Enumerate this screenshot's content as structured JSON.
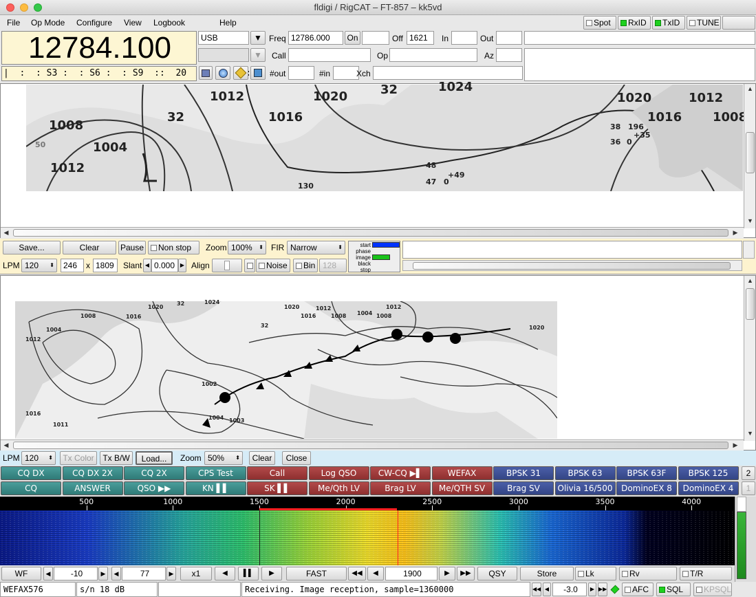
{
  "window": {
    "title": "fldigi / RigCAT – FT-857 – kk5vd"
  },
  "menu": [
    "File",
    "Op Mode",
    "Configure",
    "View",
    "Logbook",
    "Help"
  ],
  "indicators": {
    "spot": "Spot",
    "rxid": "RxID",
    "txid": "TxID",
    "tune": "TUNE"
  },
  "rig": {
    "frequency": "12784.100",
    "smeter": "|  :  : S3 :  : S6 :  : S9  ::  20  ::  40  ::  |",
    "mode": "USB",
    "bw": ""
  },
  "log": {
    "freq_label": "Freq",
    "freq_value": "12786.000",
    "on_label": "On",
    "on_value": "",
    "off_label": "Off",
    "off_value": "1621",
    "in_label": "In",
    "in_value": "",
    "out_label": "Out",
    "out_value": "",
    "call_label": "Call",
    "call_value": "",
    "op_label": "Op",
    "op_value": "",
    "az_label": "Az",
    "az_value": "",
    "nout_label": "#out",
    "nout_value": "",
    "nin_label": "#in",
    "nin_value": "",
    "xch_label": "Xch",
    "xch_value": ""
  },
  "rx_map_labels": [
    "1012",
    "1020",
    "1024",
    "32",
    "1008",
    "1016",
    "1004",
    "50",
    "1012",
    "1020",
    "1012",
    "1016",
    "1008",
    "32",
    "48",
    "47",
    "130",
    "38",
    "196",
    "36",
    "0",
    "+35",
    "+49",
    "0"
  ],
  "rx_controls": {
    "save": "Save...",
    "clear": "Clear",
    "pause": "Pause",
    "nonstop": "Non stop",
    "zoom_label": "Zoom",
    "zoom_value": "100%",
    "fir_label": "FIR",
    "fir_value": "Narrow",
    "lpm_label": "LPM",
    "lpm_value": "120",
    "width": "246",
    "x": "x",
    "height": "1809",
    "slant_label": "Slant",
    "slant_value": "0.000",
    "align_label": "Align",
    "noise": "Noise",
    "bin": "Bin",
    "bin_value": "128",
    "phases": [
      "start",
      "phase",
      "image",
      "black",
      "stop"
    ]
  },
  "tx_map_labels": [
    "1020",
    "32",
    "1024",
    "1008",
    "1004",
    "1012",
    "1016",
    "1020",
    "1016",
    "1008",
    "1012",
    "1004",
    "1008",
    "1012",
    "1020",
    "1016",
    "1011",
    "1002",
    "1004",
    "1003",
    "32"
  ],
  "tx_controls": {
    "lpm_label": "LPM",
    "lpm_value": "120",
    "tx_color": "Tx Color",
    "tx_bw": "Tx B/W",
    "load": "Load...",
    "zoom_label": "Zoom",
    "zoom_value": "50%",
    "clear": "Clear",
    "close": "Close"
  },
  "macros_row1": [
    {
      "label": "CQ DX",
      "color": "g"
    },
    {
      "label": "CQ DX 2X",
      "color": "g"
    },
    {
      "label": "CQ 2X",
      "color": "g"
    },
    {
      "label": "CPS Test",
      "color": "g"
    },
    {
      "label": "Call",
      "color": "r"
    },
    {
      "label": "Log QSO",
      "color": "r"
    },
    {
      "label": "CW-CQ ▶▌",
      "color": "r"
    },
    {
      "label": "WEFAX",
      "color": "r"
    },
    {
      "label": "BPSK 31",
      "color": "b"
    },
    {
      "label": "BPSK 63",
      "color": "b"
    },
    {
      "label": "BPSK 63F",
      "color": "b"
    },
    {
      "label": "BPSK 125",
      "color": "b"
    }
  ],
  "macros_row2": [
    {
      "label": "CQ",
      "color": "g"
    },
    {
      "label": "ANSWER",
      "color": "g"
    },
    {
      "label": "QSO ▶▶",
      "color": "g"
    },
    {
      "label": "KN ▌▌",
      "color": "g"
    },
    {
      "label": "SK ▌▌",
      "color": "r"
    },
    {
      "label": "Me/Qth LV",
      "color": "r"
    },
    {
      "label": "Brag LV",
      "color": "r"
    },
    {
      "label": "Me/QTH SV",
      "color": "r"
    },
    {
      "label": "Brag SV",
      "color": "b"
    },
    {
      "label": "Olivia 16/500",
      "color": "b"
    },
    {
      "label": "DominoEX 8",
      "color": "b"
    },
    {
      "label": "DominoEX 4",
      "color": "b"
    }
  ],
  "macro_set": {
    "top": "2",
    "bottom": "1"
  },
  "waterfall": {
    "scale": [
      "500",
      "1000",
      "1500",
      "2000",
      "2500",
      "3000",
      "3500",
      "4000"
    ],
    "scale_values": [
      500,
      1000,
      1500,
      2000,
      2500,
      3000,
      3500,
      4000
    ],
    "carrier_low": 1500,
    "carrier_high": 2300,
    "max_freq": 4250
  },
  "wf_controls": {
    "wf": "WF",
    "ref": "-10",
    "range": "77",
    "x1": "x1",
    "fast": "FAST",
    "carrier": "1900",
    "qsy": "QSY",
    "store": "Store",
    "lk": "Lk",
    "rv": "Rv",
    "tr": "T/R"
  },
  "statusbar": {
    "mode": "WEFAX576",
    "sn_label": "s/n",
    "sn_value": "18 dB",
    "imd": "",
    "message": "Receiving. Image reception, sample=1360000",
    "squelch": "-3.0",
    "afc": "AFC",
    "sql": "SQL",
    "kpsql": "KPSQL"
  },
  "colors": {
    "accent_green": "#1fd01f",
    "carrier": "#ff2020",
    "macro_green": "#3a8c89",
    "macro_red": "#a03c3c",
    "macro_blue": "#3f52a0"
  }
}
